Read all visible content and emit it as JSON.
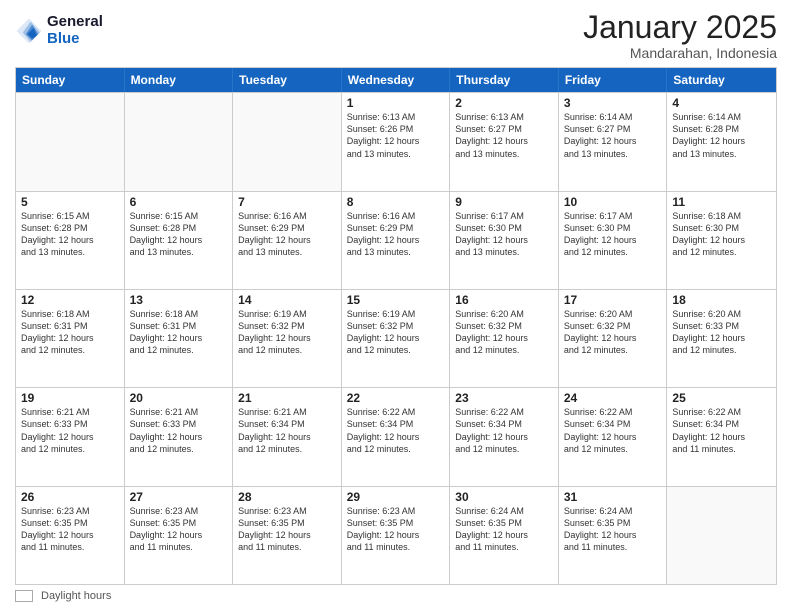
{
  "header": {
    "logo_general": "General",
    "logo_blue": "Blue",
    "month_year": "January 2025",
    "location": "Mandarahan, Indonesia"
  },
  "days_of_week": [
    "Sunday",
    "Monday",
    "Tuesday",
    "Wednesday",
    "Thursday",
    "Friday",
    "Saturday"
  ],
  "weeks": [
    [
      {
        "day": "",
        "detail": ""
      },
      {
        "day": "",
        "detail": ""
      },
      {
        "day": "",
        "detail": ""
      },
      {
        "day": "1",
        "detail": "Sunrise: 6:13 AM\nSunset: 6:26 PM\nDaylight: 12 hours\nand 13 minutes."
      },
      {
        "day": "2",
        "detail": "Sunrise: 6:13 AM\nSunset: 6:27 PM\nDaylight: 12 hours\nand 13 minutes."
      },
      {
        "day": "3",
        "detail": "Sunrise: 6:14 AM\nSunset: 6:27 PM\nDaylight: 12 hours\nand 13 minutes."
      },
      {
        "day": "4",
        "detail": "Sunrise: 6:14 AM\nSunset: 6:28 PM\nDaylight: 12 hours\nand 13 minutes."
      }
    ],
    [
      {
        "day": "5",
        "detail": "Sunrise: 6:15 AM\nSunset: 6:28 PM\nDaylight: 12 hours\nand 13 minutes."
      },
      {
        "day": "6",
        "detail": "Sunrise: 6:15 AM\nSunset: 6:28 PM\nDaylight: 12 hours\nand 13 minutes."
      },
      {
        "day": "7",
        "detail": "Sunrise: 6:16 AM\nSunset: 6:29 PM\nDaylight: 12 hours\nand 13 minutes."
      },
      {
        "day": "8",
        "detail": "Sunrise: 6:16 AM\nSunset: 6:29 PM\nDaylight: 12 hours\nand 13 minutes."
      },
      {
        "day": "9",
        "detail": "Sunrise: 6:17 AM\nSunset: 6:30 PM\nDaylight: 12 hours\nand 13 minutes."
      },
      {
        "day": "10",
        "detail": "Sunrise: 6:17 AM\nSunset: 6:30 PM\nDaylight: 12 hours\nand 12 minutes."
      },
      {
        "day": "11",
        "detail": "Sunrise: 6:18 AM\nSunset: 6:30 PM\nDaylight: 12 hours\nand 12 minutes."
      }
    ],
    [
      {
        "day": "12",
        "detail": "Sunrise: 6:18 AM\nSunset: 6:31 PM\nDaylight: 12 hours\nand 12 minutes."
      },
      {
        "day": "13",
        "detail": "Sunrise: 6:18 AM\nSunset: 6:31 PM\nDaylight: 12 hours\nand 12 minutes."
      },
      {
        "day": "14",
        "detail": "Sunrise: 6:19 AM\nSunset: 6:32 PM\nDaylight: 12 hours\nand 12 minutes."
      },
      {
        "day": "15",
        "detail": "Sunrise: 6:19 AM\nSunset: 6:32 PM\nDaylight: 12 hours\nand 12 minutes."
      },
      {
        "day": "16",
        "detail": "Sunrise: 6:20 AM\nSunset: 6:32 PM\nDaylight: 12 hours\nand 12 minutes."
      },
      {
        "day": "17",
        "detail": "Sunrise: 6:20 AM\nSunset: 6:32 PM\nDaylight: 12 hours\nand 12 minutes."
      },
      {
        "day": "18",
        "detail": "Sunrise: 6:20 AM\nSunset: 6:33 PM\nDaylight: 12 hours\nand 12 minutes."
      }
    ],
    [
      {
        "day": "19",
        "detail": "Sunrise: 6:21 AM\nSunset: 6:33 PM\nDaylight: 12 hours\nand 12 minutes."
      },
      {
        "day": "20",
        "detail": "Sunrise: 6:21 AM\nSunset: 6:33 PM\nDaylight: 12 hours\nand 12 minutes."
      },
      {
        "day": "21",
        "detail": "Sunrise: 6:21 AM\nSunset: 6:34 PM\nDaylight: 12 hours\nand 12 minutes."
      },
      {
        "day": "22",
        "detail": "Sunrise: 6:22 AM\nSunset: 6:34 PM\nDaylight: 12 hours\nand 12 minutes."
      },
      {
        "day": "23",
        "detail": "Sunrise: 6:22 AM\nSunset: 6:34 PM\nDaylight: 12 hours\nand 12 minutes."
      },
      {
        "day": "24",
        "detail": "Sunrise: 6:22 AM\nSunset: 6:34 PM\nDaylight: 12 hours\nand 12 minutes."
      },
      {
        "day": "25",
        "detail": "Sunrise: 6:22 AM\nSunset: 6:34 PM\nDaylight: 12 hours\nand 11 minutes."
      }
    ],
    [
      {
        "day": "26",
        "detail": "Sunrise: 6:23 AM\nSunset: 6:35 PM\nDaylight: 12 hours\nand 11 minutes."
      },
      {
        "day": "27",
        "detail": "Sunrise: 6:23 AM\nSunset: 6:35 PM\nDaylight: 12 hours\nand 11 minutes."
      },
      {
        "day": "28",
        "detail": "Sunrise: 6:23 AM\nSunset: 6:35 PM\nDaylight: 12 hours\nand 11 minutes."
      },
      {
        "day": "29",
        "detail": "Sunrise: 6:23 AM\nSunset: 6:35 PM\nDaylight: 12 hours\nand 11 minutes."
      },
      {
        "day": "30",
        "detail": "Sunrise: 6:24 AM\nSunset: 6:35 PM\nDaylight: 12 hours\nand 11 minutes."
      },
      {
        "day": "31",
        "detail": "Sunrise: 6:24 AM\nSunset: 6:35 PM\nDaylight: 12 hours\nand 11 minutes."
      },
      {
        "day": "",
        "detail": ""
      }
    ]
  ],
  "footer": {
    "swatch_label": "Daylight hours"
  }
}
